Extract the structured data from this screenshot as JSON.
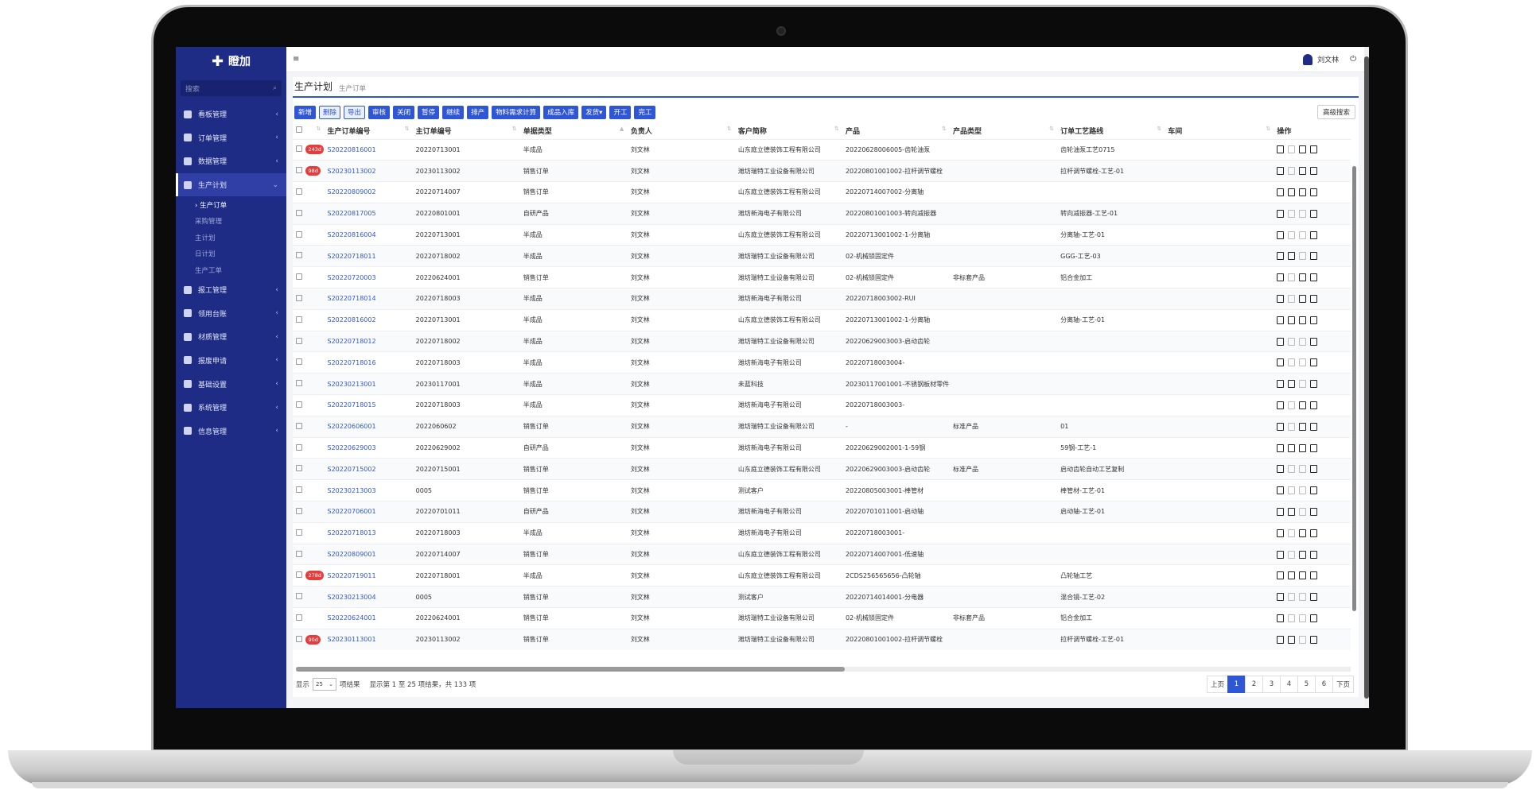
{
  "brand": "瞪加",
  "sidebar": {
    "search_placeholder": "搜索",
    "items": [
      {
        "label": "看板管理",
        "chev": "‹"
      },
      {
        "label": "订单管理",
        "chev": "‹"
      },
      {
        "label": "数据管理",
        "chev": "‹"
      },
      {
        "label": "生产计划",
        "chev": "⌄"
      },
      {
        "label": "报工管理",
        "chev": "‹"
      },
      {
        "label": "领用台账",
        "chev": "‹"
      },
      {
        "label": "材质管理",
        "chev": "‹"
      },
      {
        "label": "报废申请",
        "chev": "‹"
      },
      {
        "label": "基础设置",
        "chev": "‹"
      },
      {
        "label": "系统管理",
        "chev": "‹"
      },
      {
        "label": "信息管理",
        "chev": "‹"
      }
    ],
    "subitems": [
      "› 生产订单",
      "采购管理",
      "主计划",
      "日计划",
      "生产工单"
    ]
  },
  "topbar": {
    "menu_icon": "≡",
    "user": "刘文林",
    "power": "⏻"
  },
  "page": {
    "title": "生产计划",
    "subtitle": "生产订单"
  },
  "toolbar": {
    "buttons": [
      "新增",
      "删除",
      "导出",
      "审核",
      "关闭",
      "暂停",
      "继续",
      "排产",
      "物料需求计算",
      "成品入库",
      "发货▾",
      "开工",
      "完工"
    ],
    "advanced": "高级搜索"
  },
  "table": {
    "headers": [
      "生产订单编号",
      "主订单编号",
      "单据类型",
      "负责人",
      "客户简称",
      "产品",
      "产品类型",
      "订单工艺路线",
      "车间",
      "操作"
    ],
    "rows": [
      {
        "badge": "243d",
        "code": "S20220816001",
        "main": "20220713001",
        "type": "半成品",
        "owner": "刘文林",
        "customer": "山东庭立德装饰工程有限公司",
        "product": "20220628006005-齿轮油泵",
        "ptype": "",
        "route": "齿轮油泵工艺0715",
        "shop": ""
      },
      {
        "badge": "98d",
        "code": "S20230113002",
        "main": "20230113002",
        "type": "销售订单",
        "owner": "刘文林",
        "customer": "潍坊瑞特工业设备有限公司",
        "product": "20220801001002-拉杆调节螺栓",
        "ptype": "",
        "route": "拉杆调节螺栓-工艺-01",
        "shop": ""
      },
      {
        "badge": "",
        "code": "S20220809002",
        "main": "20220714007",
        "type": "销售订单",
        "owner": "刘文林",
        "customer": "山东庭立德装饰工程有限公司",
        "product": "20220714007002-分离轴",
        "ptype": "",
        "route": "",
        "shop": ""
      },
      {
        "badge": "",
        "code": "S20220817005",
        "main": "20220801001",
        "type": "自研产品",
        "owner": "刘文林",
        "customer": "潍坊新海电子有限公司",
        "product": "20220801001003-转向减振器",
        "ptype": "",
        "route": "转向减振器-工艺-01",
        "shop": ""
      },
      {
        "badge": "",
        "code": "S20220816004",
        "main": "20220713001",
        "type": "半成品",
        "owner": "刘文林",
        "customer": "山东庭立德装饰工程有限公司",
        "product": "20220713001002-1-分离轴",
        "ptype": "",
        "route": "分离轴-工艺-01",
        "shop": ""
      },
      {
        "badge": "",
        "code": "S20220718011",
        "main": "20220718002",
        "type": "半成品",
        "owner": "刘文林",
        "customer": "潍坊瑞特工业设备有限公司",
        "product": "02-机械锁固定件",
        "ptype": "",
        "route": "GGG-工艺-03",
        "shop": ""
      },
      {
        "badge": "",
        "code": "S20220720003",
        "main": "20220624001",
        "type": "销售订单",
        "owner": "刘文林",
        "customer": "潍坊瑞特工业设备有限公司",
        "product": "02-机械锁固定件",
        "ptype": "非标套产品",
        "route": "铝合金加工",
        "shop": ""
      },
      {
        "badge": "",
        "code": "S20220718014",
        "main": "20220718003",
        "type": "半成品",
        "owner": "刘文林",
        "customer": "潍坊新海电子有限公司",
        "product": "20220718003002-RUI",
        "ptype": "",
        "route": "",
        "shop": ""
      },
      {
        "badge": "",
        "code": "S20220816002",
        "main": "20220713001",
        "type": "半成品",
        "owner": "刘文林",
        "customer": "山东庭立德装饰工程有限公司",
        "product": "20220713001002-1-分离轴",
        "ptype": "",
        "route": "分离轴-工艺-01",
        "shop": ""
      },
      {
        "badge": "",
        "code": "S20220718012",
        "main": "20220718002",
        "type": "半成品",
        "owner": "刘文林",
        "customer": "潍坊瑞特工业设备有限公司",
        "product": "20220629003003-启动齿轮",
        "ptype": "",
        "route": "",
        "shop": ""
      },
      {
        "badge": "",
        "code": "S20220718016",
        "main": "20220718003",
        "type": "半成品",
        "owner": "刘文林",
        "customer": "潍坊新海电子有限公司",
        "product": "20220718003004-",
        "ptype": "",
        "route": "",
        "shop": ""
      },
      {
        "badge": "",
        "code": "S20230213001",
        "main": "20230117001",
        "type": "半成品",
        "owner": "刘文林",
        "customer": "未蓝科技",
        "product": "20230117001001-不锈钢板材零件",
        "ptype": "",
        "route": "",
        "shop": ""
      },
      {
        "badge": "",
        "code": "S20220718015",
        "main": "20220718003",
        "type": "半成品",
        "owner": "刘文林",
        "customer": "潍坊新海电子有限公司",
        "product": "20220718003003-",
        "ptype": "",
        "route": "",
        "shop": ""
      },
      {
        "badge": "",
        "code": "S20220606001",
        "main": "2022060602",
        "type": "销售订单",
        "owner": "刘文林",
        "customer": "潍坊瑞特工业设备有限公司",
        "product": "-",
        "ptype": "标准产品",
        "route": "01",
        "shop": ""
      },
      {
        "badge": "",
        "code": "S20220629003",
        "main": "20220629002",
        "type": "自研产品",
        "owner": "刘文林",
        "customer": "潍坊新海电子有限公司",
        "product": "20220629002001-1-59钢",
        "ptype": "",
        "route": "59钢-工艺-1",
        "shop": ""
      },
      {
        "badge": "",
        "code": "S20220715002",
        "main": "20220715001",
        "type": "销售订单",
        "owner": "刘文林",
        "customer": "山东庭立德装饰工程有限公司",
        "product": "20220629003003-启动齿轮",
        "ptype": "标准产品",
        "route": "启动齿轮自动工艺复制",
        "shop": ""
      },
      {
        "badge": "",
        "code": "S20230213003",
        "main": "0005",
        "type": "销售订单",
        "owner": "刘文林",
        "customer": "测试客户",
        "product": "20220805003001-棒管材",
        "ptype": "",
        "route": "棒管材-工艺-01",
        "shop": ""
      },
      {
        "badge": "",
        "code": "S20220706001",
        "main": "20220701011",
        "type": "自研产品",
        "owner": "刘文林",
        "customer": "潍坊新海电子有限公司",
        "product": "20220701011001-启动轴",
        "ptype": "",
        "route": "启动轴-工艺-01",
        "shop": ""
      },
      {
        "badge": "",
        "code": "S20220718013",
        "main": "20220718003",
        "type": "半成品",
        "owner": "刘文林",
        "customer": "潍坊新海电子有限公司",
        "product": "20220718003001-",
        "ptype": "",
        "route": "",
        "shop": ""
      },
      {
        "badge": "",
        "code": "S20220809001",
        "main": "20220714007",
        "type": "销售订单",
        "owner": "刘文林",
        "customer": "山东庭立德装饰工程有限公司",
        "product": "20220714007001-低速轴",
        "ptype": "",
        "route": "",
        "shop": ""
      },
      {
        "badge": "278d",
        "code": "S20220719011",
        "main": "20220718001",
        "type": "半成品",
        "owner": "刘文林",
        "customer": "山东庭立德装饰工程有限公司",
        "product": "2CDS256565656-凸轮轴",
        "ptype": "",
        "route": "凸轮轴工艺",
        "shop": ""
      },
      {
        "badge": "",
        "code": "S20230213004",
        "main": "0005",
        "type": "销售订单",
        "owner": "刘文林",
        "customer": "测试客户",
        "product": "20220714014001-分电器",
        "ptype": "",
        "route": "混合镜-工艺-02",
        "shop": ""
      },
      {
        "badge": "",
        "code": "S20220624001",
        "main": "20220624001",
        "type": "销售订单",
        "owner": "刘文林",
        "customer": "潍坊瑞特工业设备有限公司",
        "product": "02-机械锁固定件",
        "ptype": "非标套产品",
        "route": "铝合金加工",
        "shop": ""
      },
      {
        "badge": "90d",
        "code": "S20230113001",
        "main": "20230113002",
        "type": "销售订单",
        "owner": "刘文林",
        "customer": "潍坊瑞特工业设备有限公司",
        "product": "20220801001002-拉杆调节螺栓",
        "ptype": "",
        "route": "拉杆调节螺栓-工艺-01",
        "shop": ""
      }
    ]
  },
  "footer": {
    "show_label": "显示",
    "page_size": "25",
    "per_label": "项结果",
    "summary": "显示第 1 至 25 项结果，共 133 项",
    "prev": "上页",
    "pages": [
      "1",
      "2",
      "3",
      "4",
      "5",
      "6"
    ],
    "next": "下页"
  },
  "colors": {
    "sidebar": "#1e2c86",
    "accent": "#2f56d4",
    "badge": "#e53c3c"
  }
}
